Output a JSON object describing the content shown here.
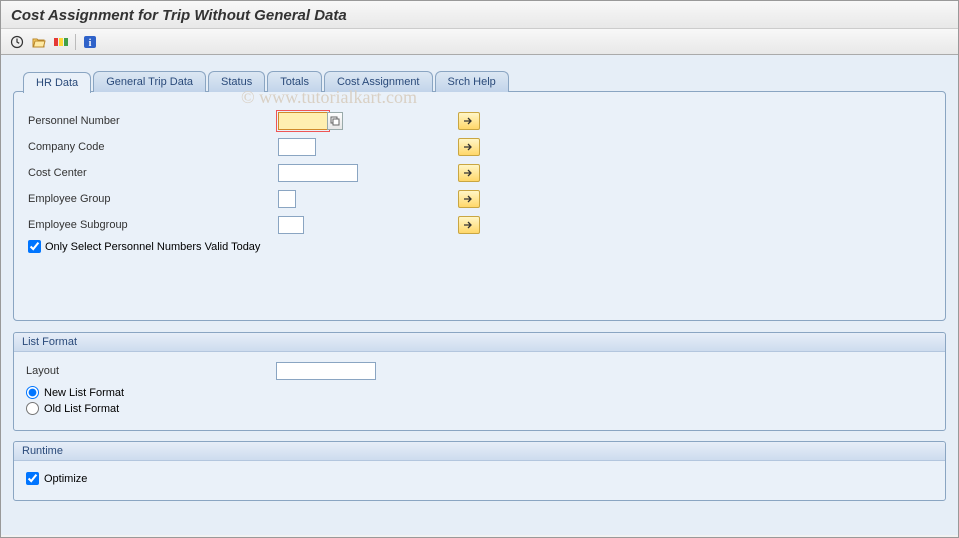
{
  "title": "Cost Assignment for Trip Without General Data",
  "watermark": "© www.tutorialkart.com",
  "tabs": {
    "hr_data": "HR Data",
    "general_trip_data": "General Trip Data",
    "status": "Status",
    "totals": "Totals",
    "cost_assignment": "Cost Assignment",
    "srch_help": "Srch Help"
  },
  "fields": {
    "personnel_number": {
      "label": "Personnel Number",
      "value": ""
    },
    "company_code": {
      "label": "Company Code",
      "value": ""
    },
    "cost_center": {
      "label": "Cost Center",
      "value": ""
    },
    "employee_group": {
      "label": "Employee Group",
      "value": ""
    },
    "employee_subgroup": {
      "label": "Employee Subgroup",
      "value": ""
    },
    "only_valid_today": {
      "label": "Only Select Personnel Numbers Valid Today",
      "checked": true
    }
  },
  "list_format": {
    "title": "List Format",
    "layout_label": "Layout",
    "layout_value": "",
    "new_list_format": "New List Format",
    "old_list_format": "Old List Format",
    "selected": "new"
  },
  "runtime": {
    "title": "Runtime",
    "optimize_label": "Optimize",
    "optimize_checked": true
  }
}
